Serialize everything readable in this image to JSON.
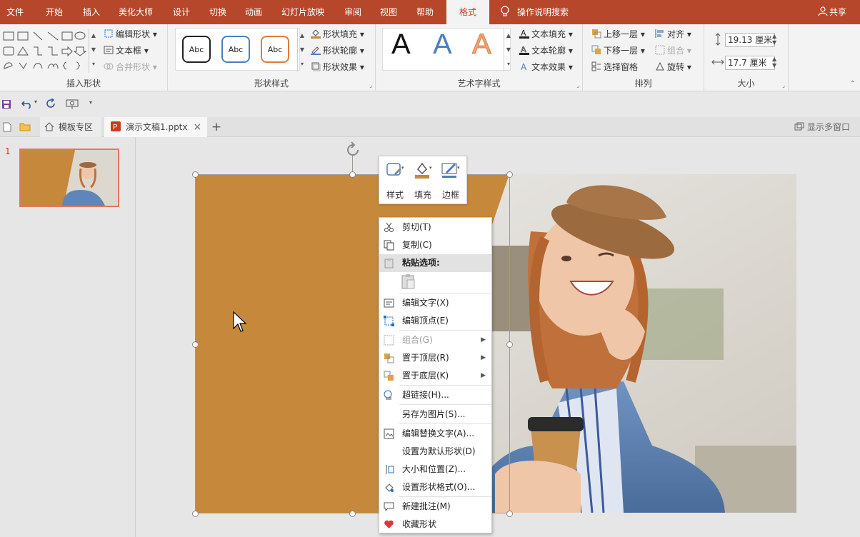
{
  "colors": {
    "accent": "#b7472a",
    "shape_fill": "#c6883a",
    "selected_thumb": "#e07a5f"
  },
  "ribbon_tabs": [
    "文件",
    "开始",
    "插入",
    "美化大师",
    "设计",
    "切换",
    "动画",
    "幻灯片放映",
    "审阅",
    "视图",
    "帮助",
    "格式"
  ],
  "active_tab": "格式",
  "search": {
    "label": "操作说明搜索"
  },
  "share": {
    "label": "共享"
  },
  "insert_shapes": {
    "group_label": "插入形状",
    "edit_shape": "编辑形状",
    "text_box": "文本框",
    "merge_shapes": "合并形状"
  },
  "shape_styles": {
    "group_label": "形状样式",
    "swatch_text": "Abc",
    "fill": "形状填充",
    "outline": "形状轮廓",
    "effects": "形状效果"
  },
  "wordart": {
    "group_label": "艺术字样式",
    "letter": "A",
    "text_fill": "文本填充",
    "text_outline": "文本轮廓",
    "text_effects": "文本效果"
  },
  "arrange": {
    "group_label": "排列",
    "bring_forward": "上移一层",
    "send_backward": "下移一层",
    "selection_pane": "选择窗格",
    "align": "对齐",
    "group": "组合",
    "rotate": "旋转"
  },
  "size": {
    "group_label": "大小",
    "height": "19.13 厘米",
    "width": "17.7 厘米"
  },
  "doc_tabs": {
    "template": "模板专区",
    "file": "演示文稿1.pptx",
    "multi_window": "显示多窗口"
  },
  "slide_panel": {
    "slide_number": "1"
  },
  "mini_toolbar": {
    "style": "样式",
    "fill": "填充",
    "border": "边框"
  },
  "context_menu": {
    "cut": "剪切(T)",
    "copy": "复制(C)",
    "paste_options": "粘贴选项:",
    "edit_text": "编辑文字(X)",
    "edit_points": "编辑顶点(E)",
    "group": "组合(G)",
    "bring_to_front": "置于顶层(R)",
    "send_to_back": "置于底层(K)",
    "hyperlink": "超链接(H)...",
    "save_as_picture": "另存为图片(S)...",
    "edit_alt_text": "编辑替换文字(A)...",
    "set_default_shape": "设置为默认形状(D)",
    "size_position": "大小和位置(Z)...",
    "format_shape": "设置形状格式(O)...",
    "new_comment": "新建批注(M)",
    "favorite_shape": "收藏形状"
  }
}
